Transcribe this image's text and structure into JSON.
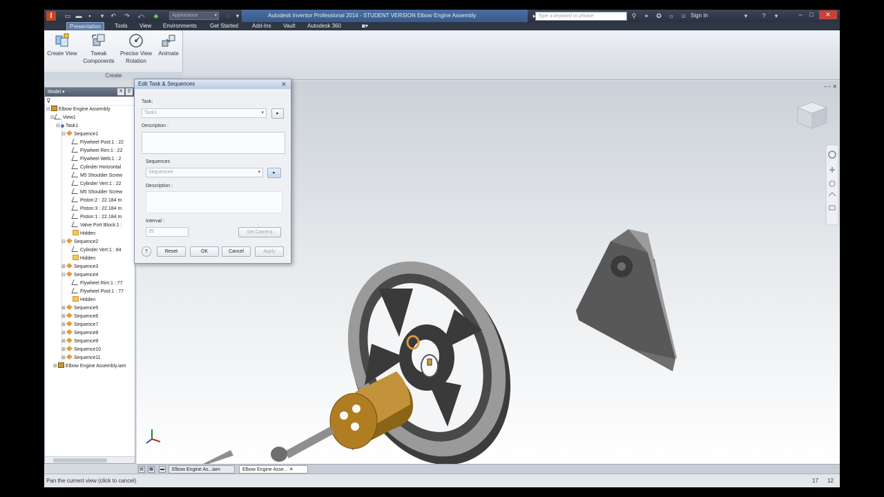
{
  "titlebar": {
    "appearance": "Appearance",
    "title": "Autodesk Inventor Professional 2014 - STUDENT VERSION   Elbow Engine Assembly",
    "search_placeholder": "Type a keyword or phrase",
    "sign_in": "Sign In"
  },
  "menu": {
    "tabs": [
      "Presentation",
      "Tools",
      "View",
      "Environments",
      "Get Started",
      "Add-Ins",
      "Vault",
      "Autodesk 360"
    ]
  },
  "ribbon": {
    "buttons": [
      {
        "label": "Create View",
        "icon": "create-view-icon"
      },
      {
        "label": "Tweak Components",
        "icon": "tweak-components-icon"
      },
      {
        "label": "Precise View Rotation",
        "icon": "precise-rotation-icon"
      },
      {
        "label": "Animate",
        "icon": "animate-icon"
      }
    ],
    "panel_label": "Create"
  },
  "browser": {
    "title": "Model",
    "tree": [
      {
        "label": "Elbow Engine Assembly"
      },
      {
        "label": "View1"
      },
      {
        "label": "Task1"
      },
      {
        "label": "Sequence1"
      },
      {
        "label": "Flywheel Post:1 : 22"
      },
      {
        "label": "Flywheel Rim:1 : 22"
      },
      {
        "label": "Flywheel Web:1 : 2"
      },
      {
        "label": "Cylinder Horizontal"
      },
      {
        "label": "M5 Shoulder Screw"
      },
      {
        "label": "Cylinder Vert:1 : 22"
      },
      {
        "label": "M5 Shoulder Screw"
      },
      {
        "label": "Piston:2 : 22.184 m"
      },
      {
        "label": "Piston:3 : 22.184 m"
      },
      {
        "label": "Piston:1 : 22.184 m"
      },
      {
        "label": "Valve Port Block:1 :"
      },
      {
        "label": "Hidden"
      },
      {
        "label": "Sequence2"
      },
      {
        "label": "Cylinder Vert:1 : 84"
      },
      {
        "label": "Hidden"
      },
      {
        "label": "Sequence3"
      },
      {
        "label": "Sequence4"
      },
      {
        "label": "Flywheel Rim:1 : 77"
      },
      {
        "label": "Flywheel Post:1 : 77"
      },
      {
        "label": "Hidden"
      },
      {
        "label": "Sequence5"
      },
      {
        "label": "Sequence6"
      },
      {
        "label": "Sequence7"
      },
      {
        "label": "Sequence8"
      },
      {
        "label": "Sequence9"
      },
      {
        "label": "Sequence10"
      },
      {
        "label": "Sequence11"
      },
      {
        "label": "Elbow Engine Assembly.iam"
      }
    ]
  },
  "dialog": {
    "title": "Edit Task & Sequences",
    "task_label": "Task:",
    "task_value": "Task1",
    "description_label": "Description :",
    "sequences_label": "Sequences",
    "sequence_value": "Sequence4",
    "seq_description_label": "Description :",
    "interval_label": "Interval :",
    "interval_value": "25",
    "set_camera": "Set Camera",
    "reset": "Reset",
    "ok": "OK",
    "cancel": "Cancel",
    "apply": "Apply"
  },
  "doc_tabs": [
    "Elbow Engine As...iam",
    "Elbow Engine Asse..."
  ],
  "status": {
    "text": "Pan the current view (click to cancel)",
    "n1": "17",
    "n2": "12"
  }
}
